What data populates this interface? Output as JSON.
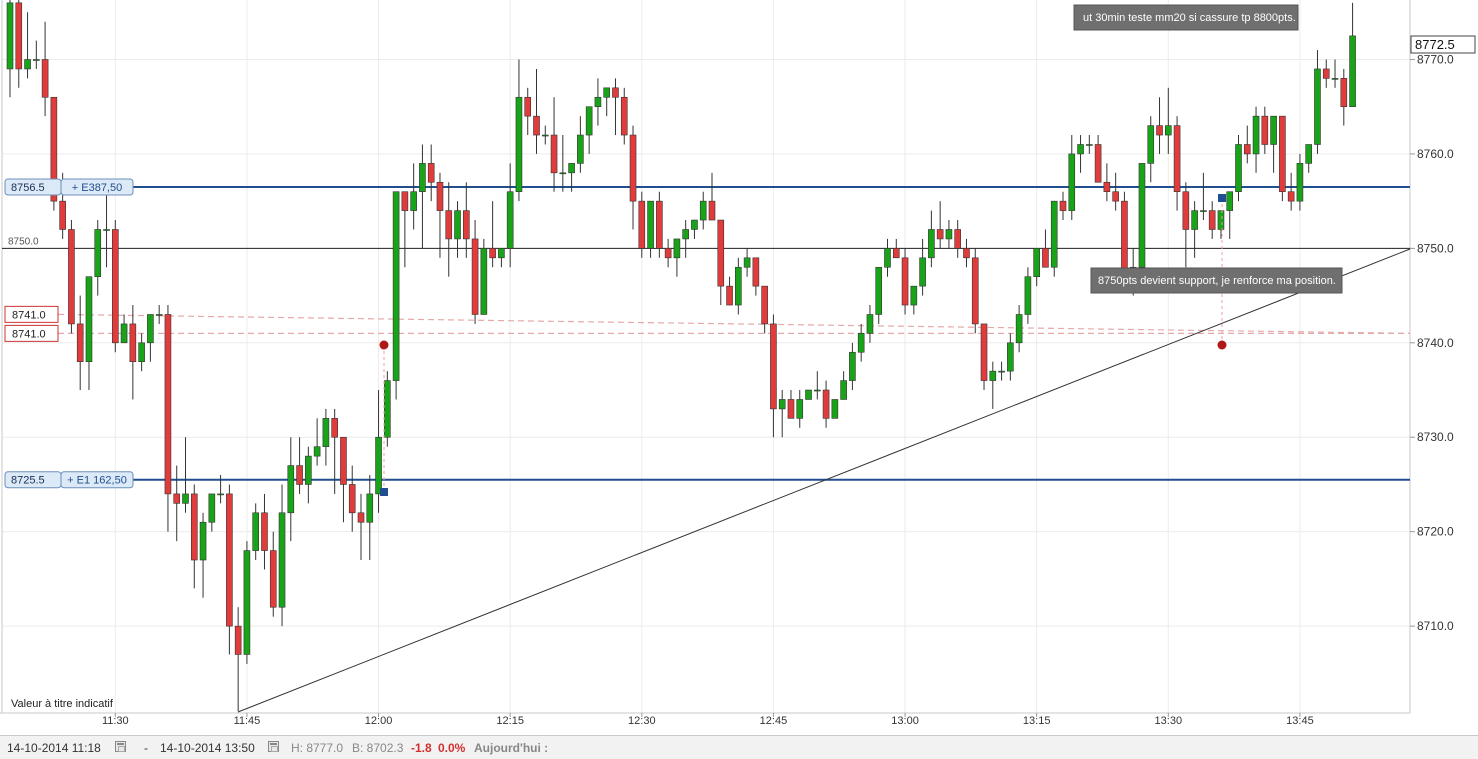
{
  "chart_data": {
    "type": "candlestick",
    "ylim": [
      8700.8,
      8776.3
    ],
    "y_ticks": [
      8710.0,
      8720.0,
      8730.0,
      8740.0,
      8750.0,
      8760.0,
      8770.0
    ],
    "x_ticks": [
      "11:30",
      "11:45",
      "12:00",
      "12:15",
      "12:30",
      "12:45",
      "13:00",
      "13:15",
      "13:30",
      "13:45"
    ],
    "grid": true,
    "last_price": "8772.5",
    "candles": [
      {
        "time": "11:18",
        "o": 8769,
        "h": 8777,
        "l": 8766,
        "c": 8776
      },
      {
        "time": "11:19",
        "o": 8776,
        "h": 8777,
        "l": 8767,
        "c": 8769
      },
      {
        "time": "11:20",
        "o": 8769,
        "h": 8775,
        "l": 8768,
        "c": 8770
      },
      {
        "time": "11:21",
        "o": 8770,
        "h": 8772,
        "l": 8769,
        "c": 8770
      },
      {
        "time": "11:22",
        "o": 8770,
        "h": 8774,
        "l": 8764,
        "c": 8766
      },
      {
        "time": "11:23",
        "o": 8766,
        "h": 8766,
        "l": 8754,
        "c": 8755
      },
      {
        "time": "11:24",
        "o": 8755,
        "h": 8758,
        "l": 8751,
        "c": 8752
      },
      {
        "time": "11:25",
        "o": 8752,
        "h": 8753,
        "l": 8741,
        "c": 8742
      },
      {
        "time": "11:26",
        "o": 8742,
        "h": 8745,
        "l": 8735,
        "c": 8738
      },
      {
        "time": "11:27",
        "o": 8738,
        "h": 8745,
        "l": 8735,
        "c": 8747
      },
      {
        "time": "11:28",
        "o": 8747,
        "h": 8753,
        "l": 8745,
        "c": 8752
      },
      {
        "time": "11:29",
        "o": 8752,
        "h": 8757,
        "l": 8748,
        "c": 8752
      },
      {
        "time": "11:30",
        "o": 8752,
        "h": 8753,
        "l": 8739,
        "c": 8740
      },
      {
        "time": "11:31",
        "o": 8740,
        "h": 8743,
        "l": 8740,
        "c": 8742
      },
      {
        "time": "11:32",
        "o": 8742,
        "h": 8744,
        "l": 8734,
        "c": 8738
      },
      {
        "time": "11:33",
        "o": 8738,
        "h": 8741,
        "l": 8737,
        "c": 8740
      },
      {
        "time": "11:34",
        "o": 8740,
        "h": 8743,
        "l": 8738,
        "c": 8743
      },
      {
        "time": "11:35",
        "o": 8743,
        "h": 8744,
        "l": 8742,
        "c": 8743
      },
      {
        "time": "11:36",
        "o": 8743,
        "h": 8744,
        "l": 8720,
        "c": 8724
      },
      {
        "time": "11:37",
        "o": 8724,
        "h": 8727,
        "l": 8719,
        "c": 8723
      },
      {
        "time": "11:38",
        "o": 8723,
        "h": 8730,
        "l": 8722,
        "c": 8724
      },
      {
        "time": "11:39",
        "o": 8724,
        "h": 8725,
        "l": 8714,
        "c": 8717
      },
      {
        "time": "11:40",
        "o": 8717,
        "h": 8722,
        "l": 8713,
        "c": 8721
      },
      {
        "time": "11:41",
        "o": 8721,
        "h": 8724,
        "l": 8720,
        "c": 8724
      },
      {
        "time": "11:42",
        "o": 8724,
        "h": 8726,
        "l": 8723,
        "c": 8724
      },
      {
        "time": "11:43",
        "o": 8724,
        "h": 8725,
        "l": 8707,
        "c": 8710
      },
      {
        "time": "11:44",
        "o": 8710,
        "h": 8712,
        "l": 8701,
        "c": 8707
      },
      {
        "time": "11:45",
        "o": 8707,
        "h": 8719,
        "l": 8706,
        "c": 8718
      },
      {
        "time": "11:46",
        "o": 8718,
        "h": 8723,
        "l": 8717,
        "c": 8722
      },
      {
        "time": "11:47",
        "o": 8722,
        "h": 8724,
        "l": 8716,
        "c": 8718
      },
      {
        "time": "11:48",
        "o": 8718,
        "h": 8720,
        "l": 8711,
        "c": 8712
      },
      {
        "time": "11:49",
        "o": 8712,
        "h": 8725,
        "l": 8710,
        "c": 8722
      },
      {
        "time": "11:50",
        "o": 8722,
        "h": 8730,
        "l": 8719,
        "c": 8727
      },
      {
        "time": "11:51",
        "o": 8727,
        "h": 8730,
        "l": 8724,
        "c": 8725
      },
      {
        "time": "11:52",
        "o": 8725,
        "h": 8729,
        "l": 8723,
        "c": 8728
      },
      {
        "time": "11:53",
        "o": 8728,
        "h": 8732,
        "l": 8727,
        "c": 8729
      },
      {
        "time": "11:54",
        "o": 8729,
        "h": 8733,
        "l": 8727,
        "c": 8732
      },
      {
        "time": "11:55",
        "o": 8732,
        "h": 8733,
        "l": 8724,
        "c": 8730
      },
      {
        "time": "11:56",
        "o": 8730,
        "h": 8730,
        "l": 8721,
        "c": 8725
      },
      {
        "time": "11:57",
        "o": 8725,
        "h": 8727,
        "l": 8720,
        "c": 8722
      },
      {
        "time": "11:58",
        "o": 8722,
        "h": 8724,
        "l": 8717,
        "c": 8721
      },
      {
        "time": "11:59",
        "o": 8721,
        "h": 8726,
        "l": 8717,
        "c": 8724
      },
      {
        "time": "12:00",
        "o": 8724,
        "h": 8735,
        "l": 8722,
        "c": 8730
      },
      {
        "time": "12:01",
        "o": 8730,
        "h": 8737,
        "l": 8729,
        "c": 8736
      },
      {
        "time": "12:02",
        "o": 8736,
        "h": 8756,
        "l": 8734,
        "c": 8756
      },
      {
        "time": "12:03",
        "o": 8756,
        "h": 8756,
        "l": 8748,
        "c": 8754
      },
      {
        "time": "12:04",
        "o": 8754,
        "h": 8759,
        "l": 8752,
        "c": 8756
      },
      {
        "time": "12:05",
        "o": 8756,
        "h": 8761,
        "l": 8750,
        "c": 8759
      },
      {
        "time": "12:06",
        "o": 8759,
        "h": 8761,
        "l": 8755,
        "c": 8757
      },
      {
        "time": "12:07",
        "o": 8757,
        "h": 8758,
        "l": 8749,
        "c": 8754
      },
      {
        "time": "12:08",
        "o": 8754,
        "h": 8757,
        "l": 8747,
        "c": 8751
      },
      {
        "time": "12:09",
        "o": 8751,
        "h": 8755,
        "l": 8749,
        "c": 8754
      },
      {
        "time": "12:10",
        "o": 8754,
        "h": 8757,
        "l": 8749,
        "c": 8751
      },
      {
        "time": "12:11",
        "o": 8751,
        "h": 8753,
        "l": 8742,
        "c": 8743
      },
      {
        "time": "12:12",
        "o": 8743,
        "h": 8751,
        "l": 8743,
        "c": 8750
      },
      {
        "time": "12:13",
        "o": 8750,
        "h": 8755,
        "l": 8748,
        "c": 8749
      },
      {
        "time": "12:14",
        "o": 8749,
        "h": 8750,
        "l": 8748,
        "c": 8750
      },
      {
        "time": "12:15",
        "o": 8750,
        "h": 8759,
        "l": 8748,
        "c": 8756
      },
      {
        "time": "12:16",
        "o": 8756,
        "h": 8770,
        "l": 8755,
        "c": 8766
      },
      {
        "time": "12:17",
        "o": 8766,
        "h": 8767,
        "l": 8762,
        "c": 8764
      },
      {
        "time": "12:18",
        "o": 8764,
        "h": 8769,
        "l": 8760,
        "c": 8762
      },
      {
        "time": "12:19",
        "o": 8762,
        "h": 8763,
        "l": 8761,
        "c": 8762
      },
      {
        "time": "12:20",
        "o": 8762,
        "h": 8766,
        "l": 8756,
        "c": 8758
      },
      {
        "time": "12:21",
        "o": 8758,
        "h": 8762,
        "l": 8756,
        "c": 8758
      },
      {
        "time": "12:22",
        "o": 8758,
        "h": 8759,
        "l": 8756,
        "c": 8759
      },
      {
        "time": "12:23",
        "o": 8759,
        "h": 8764,
        "l": 8758,
        "c": 8762
      },
      {
        "time": "12:24",
        "o": 8762,
        "h": 8765,
        "l": 8760,
        "c": 8765
      },
      {
        "time": "12:25",
        "o": 8765,
        "h": 8768,
        "l": 8763,
        "c": 8766
      },
      {
        "time": "12:26",
        "o": 8766,
        "h": 8767,
        "l": 8764,
        "c": 8767
      },
      {
        "time": "12:27",
        "o": 8767,
        "h": 8768,
        "l": 8762,
        "c": 8766
      },
      {
        "time": "12:28",
        "o": 8766,
        "h": 8767,
        "l": 8761,
        "c": 8762
      },
      {
        "time": "12:29",
        "o": 8762,
        "h": 8763,
        "l": 8752,
        "c": 8755
      },
      {
        "time": "12:30",
        "o": 8755,
        "h": 8756,
        "l": 8749,
        "c": 8750
      },
      {
        "time": "12:31",
        "o": 8750,
        "h": 8755,
        "l": 8749,
        "c": 8755
      },
      {
        "time": "12:32",
        "o": 8755,
        "h": 8756,
        "l": 8749,
        "c": 8750
      },
      {
        "time": "12:33",
        "o": 8750,
        "h": 8751,
        "l": 8748,
        "c": 8749
      },
      {
        "time": "12:34",
        "o": 8749,
        "h": 8751,
        "l": 8747,
        "c": 8751
      },
      {
        "time": "12:35",
        "o": 8751,
        "h": 8753,
        "l": 8749,
        "c": 8752
      },
      {
        "time": "12:36",
        "o": 8752,
        "h": 8753,
        "l": 8751,
        "c": 8753
      },
      {
        "time": "12:37",
        "o": 8753,
        "h": 8756,
        "l": 8752,
        "c": 8755
      },
      {
        "time": "12:38",
        "o": 8755,
        "h": 8758,
        "l": 8753,
        "c": 8753
      },
      {
        "time": "12:39",
        "o": 8753,
        "h": 8753,
        "l": 8744,
        "c": 8746
      },
      {
        "time": "12:40",
        "o": 8746,
        "h": 8747,
        "l": 8744,
        "c": 8744
      },
      {
        "time": "12:41",
        "o": 8744,
        "h": 8749,
        "l": 8743,
        "c": 8748
      },
      {
        "time": "12:42",
        "o": 8748,
        "h": 8750,
        "l": 8747,
        "c": 8749
      },
      {
        "time": "12:43",
        "o": 8749,
        "h": 8749,
        "l": 8745,
        "c": 8746
      },
      {
        "time": "12:44",
        "o": 8746,
        "h": 8746,
        "l": 8741,
        "c": 8742
      },
      {
        "time": "12:45",
        "o": 8742,
        "h": 8743,
        "l": 8730,
        "c": 8733
      },
      {
        "time": "12:46",
        "o": 8733,
        "h": 8735,
        "l": 8730,
        "c": 8734
      },
      {
        "time": "12:47",
        "o": 8734,
        "h": 8735,
        "l": 8732,
        "c": 8732
      },
      {
        "time": "12:48",
        "o": 8732,
        "h": 8735,
        "l": 8731,
        "c": 8734
      },
      {
        "time": "12:49",
        "o": 8734,
        "h": 8735,
        "l": 8734,
        "c": 8735
      },
      {
        "time": "12:50",
        "o": 8735,
        "h": 8737,
        "l": 8734,
        "c": 8735
      },
      {
        "time": "12:51",
        "o": 8735,
        "h": 8736,
        "l": 8731,
        "c": 8732
      },
      {
        "time": "12:52",
        "o": 8732,
        "h": 8734,
        "l": 8732,
        "c": 8734
      },
      {
        "time": "12:53",
        "o": 8734,
        "h": 8737,
        "l": 8734,
        "c": 8736
      },
      {
        "time": "12:54",
        "o": 8736,
        "h": 8740,
        "l": 8735,
        "c": 8739
      },
      {
        "time": "12:55",
        "o": 8739,
        "h": 8742,
        "l": 8738,
        "c": 8741
      },
      {
        "time": "12:56",
        "o": 8741,
        "h": 8744,
        "l": 8740,
        "c": 8743
      },
      {
        "time": "12:57",
        "o": 8743,
        "h": 8748,
        "l": 8742,
        "c": 8748
      },
      {
        "time": "12:58",
        "o": 8748,
        "h": 8751,
        "l": 8747,
        "c": 8750
      },
      {
        "time": "12:59",
        "o": 8750,
        "h": 8751,
        "l": 8749,
        "c": 8749
      },
      {
        "time": "13:00",
        "o": 8749,
        "h": 8750,
        "l": 8743,
        "c": 8744
      },
      {
        "time": "13:01",
        "o": 8744,
        "h": 8746,
        "l": 8743,
        "c": 8746
      },
      {
        "time": "13:02",
        "o": 8746,
        "h": 8751,
        "l": 8745,
        "c": 8749
      },
      {
        "time": "13:03",
        "o": 8749,
        "h": 8754,
        "l": 8748,
        "c": 8752
      },
      {
        "time": "13:04",
        "o": 8752,
        "h": 8755,
        "l": 8750,
        "c": 8751
      },
      {
        "time": "13:05",
        "o": 8751,
        "h": 8753,
        "l": 8750,
        "c": 8752
      },
      {
        "time": "13:06",
        "o": 8752,
        "h": 8753,
        "l": 8749,
        "c": 8750
      },
      {
        "time": "13:07",
        "o": 8750,
        "h": 8751,
        "l": 8748,
        "c": 8749
      },
      {
        "time": "13:08",
        "o": 8749,
        "h": 8750,
        "l": 8741,
        "c": 8742
      },
      {
        "time": "13:09",
        "o": 8742,
        "h": 8742,
        "l": 8735,
        "c": 8736
      },
      {
        "time": "13:10",
        "o": 8736,
        "h": 8738,
        "l": 8733,
        "c": 8737
      },
      {
        "time": "13:11",
        "o": 8737,
        "h": 8738,
        "l": 8736,
        "c": 8737
      },
      {
        "time": "13:12",
        "o": 8737,
        "h": 8741,
        "l": 8736,
        "c": 8740
      },
      {
        "time": "13:13",
        "o": 8740,
        "h": 8744,
        "l": 8739,
        "c": 8743
      },
      {
        "time": "13:14",
        "o": 8743,
        "h": 8748,
        "l": 8742,
        "c": 8747
      },
      {
        "time": "13:15",
        "o": 8747,
        "h": 8750,
        "l": 8746,
        "c": 8750
      },
      {
        "time": "13:16",
        "o": 8750,
        "h": 8752,
        "l": 8748,
        "c": 8748
      },
      {
        "time": "13:17",
        "o": 8748,
        "h": 8755,
        "l": 8747,
        "c": 8755
      },
      {
        "time": "13:18",
        "o": 8755,
        "h": 8756,
        "l": 8753,
        "c": 8754
      },
      {
        "time": "13:19",
        "o": 8754,
        "h": 8762,
        "l": 8753,
        "c": 8760
      },
      {
        "time": "13:20",
        "o": 8760,
        "h": 8762,
        "l": 8758,
        "c": 8761
      },
      {
        "time": "13:21",
        "o": 8761,
        "h": 8762,
        "l": 8760,
        "c": 8761
      },
      {
        "time": "13:22",
        "o": 8761,
        "h": 8762,
        "l": 8757,
        "c": 8757
      },
      {
        "time": "13:23",
        "o": 8757,
        "h": 8759,
        "l": 8755,
        "c": 8756
      },
      {
        "time": "13:24",
        "o": 8756,
        "h": 8758,
        "l": 8754,
        "c": 8755
      },
      {
        "time": "13:25",
        "o": 8755,
        "h": 8756,
        "l": 8746,
        "c": 8747
      },
      {
        "time": "13:26",
        "o": 8747,
        "h": 8750,
        "l": 8745,
        "c": 8748
      },
      {
        "time": "13:27",
        "o": 8748,
        "h": 8759,
        "l": 8746,
        "c": 8759
      },
      {
        "time": "13:28",
        "o": 8759,
        "h": 8764,
        "l": 8757,
        "c": 8763
      },
      {
        "time": "13:29",
        "o": 8763,
        "h": 8766,
        "l": 8760,
        "c": 8762
      },
      {
        "time": "13:30",
        "o": 8762,
        "h": 8767,
        "l": 8760,
        "c": 8763
      },
      {
        "time": "13:31",
        "o": 8763,
        "h": 8764,
        "l": 8754,
        "c": 8756
      },
      {
        "time": "13:32",
        "o": 8756,
        "h": 8757,
        "l": 8748,
        "c": 8752
      },
      {
        "time": "13:33",
        "o": 8752,
        "h": 8755,
        "l": 8749,
        "c": 8754
      },
      {
        "time": "13:34",
        "o": 8754,
        "h": 8758,
        "l": 8753,
        "c": 8754
      },
      {
        "time": "13:35",
        "o": 8754,
        "h": 8755,
        "l": 8751,
        "c": 8752
      },
      {
        "time": "13:36",
        "o": 8752,
        "h": 8754,
        "l": 8751,
        "c": 8754
      },
      {
        "time": "13:37",
        "o": 8754,
        "h": 8756,
        "l": 8751,
        "c": 8756
      },
      {
        "time": "13:38",
        "o": 8756,
        "h": 8762,
        "l": 8755,
        "c": 8761
      },
      {
        "time": "13:39",
        "o": 8761,
        "h": 8763,
        "l": 8759,
        "c": 8760
      },
      {
        "time": "13:40",
        "o": 8760,
        "h": 8765,
        "l": 8758,
        "c": 8764
      },
      {
        "time": "13:41",
        "o": 8764,
        "h": 8765,
        "l": 8760,
        "c": 8761
      },
      {
        "time": "13:42",
        "o": 8761,
        "h": 8764,
        "l": 8758,
        "c": 8764
      },
      {
        "time": "13:43",
        "o": 8764,
        "h": 8764,
        "l": 8755,
        "c": 8756
      },
      {
        "time": "13:44",
        "o": 8756,
        "h": 8758,
        "l": 8754,
        "c": 8755
      },
      {
        "time": "13:45",
        "o": 8755,
        "h": 8760,
        "l": 8754,
        "c": 8759
      },
      {
        "time": "13:46",
        "o": 8759,
        "h": 8761,
        "l": 8758,
        "c": 8761
      },
      {
        "time": "13:47",
        "o": 8761,
        "h": 8771,
        "l": 8760,
        "c": 8769
      },
      {
        "time": "13:48",
        "o": 8769,
        "h": 8770,
        "l": 8767,
        "c": 8768
      },
      {
        "time": "13:49",
        "o": 8768,
        "h": 8770,
        "l": 8767,
        "c": 8768
      },
      {
        "time": "13:50",
        "o": 8768,
        "h": 8769,
        "l": 8763,
        "c": 8765
      },
      {
        "time": "13:51",
        "o": 8765,
        "h": 8776,
        "l": 8765,
        "c": 8772.5
      }
    ],
    "horizontal_lines": [
      {
        "price": 8756.5,
        "label": "8756.5",
        "tag": "+ E387,50",
        "color": "#1f4f8f"
      },
      {
        "price": 8725.5,
        "label": "8725.5",
        "tag": "+ E1 162,50",
        "color": "#1f4f8f"
      },
      {
        "price": 8750.0,
        "label": "8750.0",
        "color": "#222222"
      }
    ],
    "alert_lines": [
      {
        "price": 8741.0,
        "label": "8741.0"
      },
      {
        "price": 8741.0,
        "label": "8741.0"
      }
    ],
    "annotations": [
      {
        "text": "ut 30min teste mm20 si cassure tp 8800pts."
      },
      {
        "text": "8750pts devient support, je renforce ma position."
      }
    ],
    "watermark": "Valeur à titre indicatif",
    "colors": {
      "up": "#19a319",
      "down": "#e03c3c",
      "line": "#1f4f8f",
      "marker": "#b01818"
    }
  },
  "footer": {
    "start": "14-10-2014 11:18",
    "separator": "-",
    "end": "14-10-2014 13:50",
    "high": "H: 8777.0",
    "low": "B: 8702.3",
    "change": "-1.8",
    "change_pct": "0.0%",
    "today": "Aujourd'hui :"
  }
}
